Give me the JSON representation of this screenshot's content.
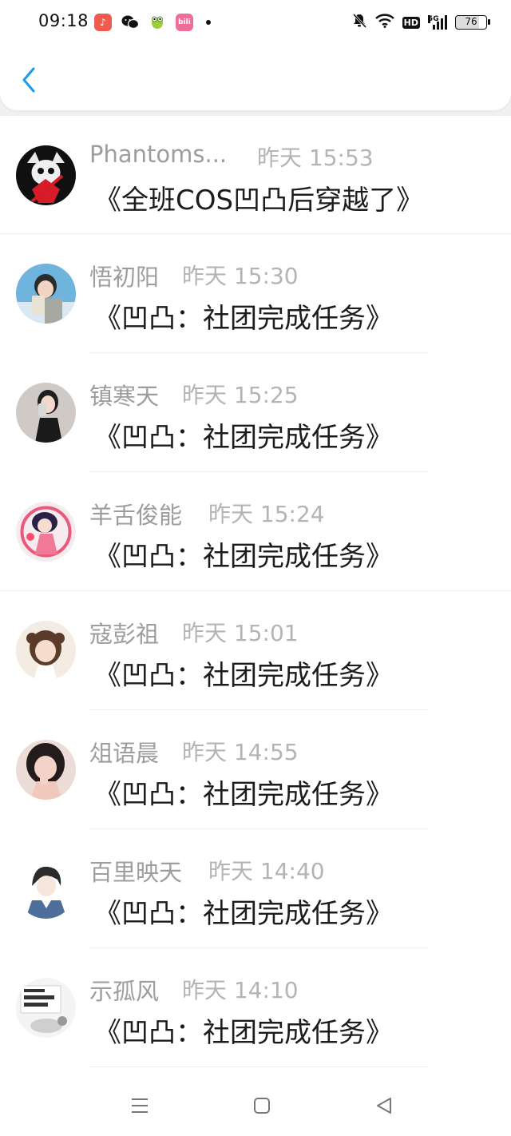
{
  "status_bar": {
    "time": "09:18",
    "app_icons": [
      "music-icon",
      "wechat-icon",
      "frog-app-icon",
      "bilibili-icon"
    ],
    "battery": "76",
    "network": "5G",
    "hd": "HD"
  },
  "nav": {
    "back_icon": "chevron-left-icon",
    "accent_color": "#1a9bf0"
  },
  "messages": [
    {
      "user": "Phantoms...",
      "time": "昨天 15:53",
      "text": "《全班COS凹凸后穿越了》"
    },
    {
      "user": "悟初阳",
      "time": "昨天 15:30",
      "text": "《凹凸：社团完成任务》"
    },
    {
      "user": "镇寒天",
      "time": "昨天 15:25",
      "text": "《凹凸：社团完成任务》"
    },
    {
      "user": "羊舌俊能",
      "time": "昨天 15:24",
      "text": "《凹凸：社团完成任务》"
    },
    {
      "user": "寇彭祖",
      "time": "昨天 15:01",
      "text": "《凹凸：社团完成任务》"
    },
    {
      "user": "俎语晨",
      "time": "昨天 14:55",
      "text": "《凹凸：社团完成任务》"
    },
    {
      "user": "百里映天",
      "time": "昨天 14:40",
      "text": "《凹凸：社团完成任务》"
    },
    {
      "user": "示孤风",
      "time": "昨天 14:10",
      "text": "《凹凸：社团完成任务》"
    }
  ],
  "bottom_nav": [
    "menu-icon",
    "home-icon",
    "back-triangle-icon"
  ]
}
